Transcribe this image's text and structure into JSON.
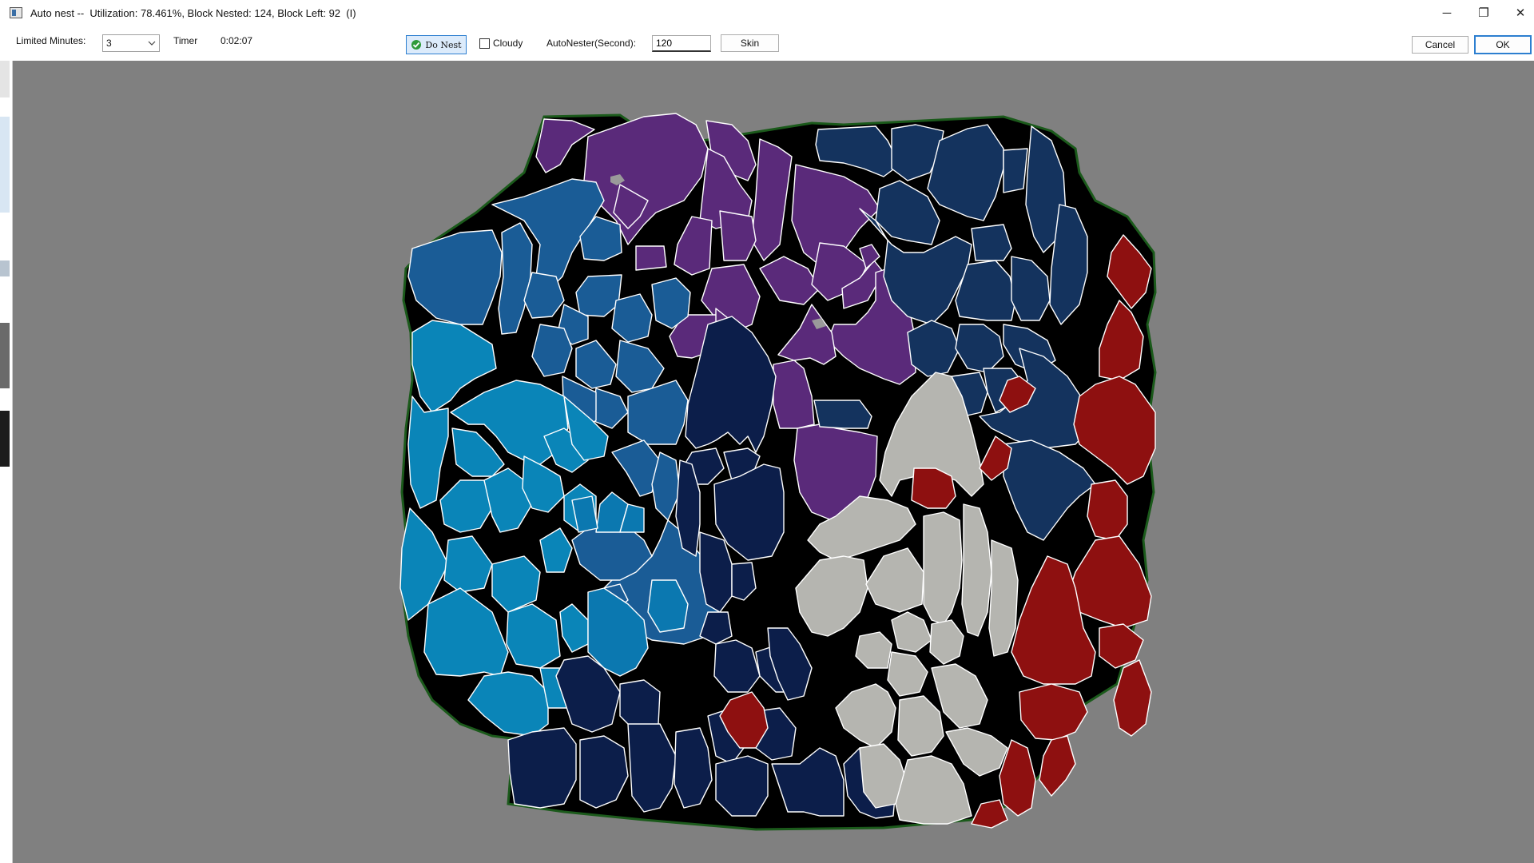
{
  "window": {
    "title": "Auto nest --  Utilization: 78.461%, Block Nested: 124, Block Left: 92  (I)",
    "minimize_glyph": "─",
    "maximize_glyph": "❐",
    "close_glyph": "✕"
  },
  "toolbar": {
    "limited_minutes_label": "Limited Minutes:",
    "limited_minutes_value": "3",
    "timer_label": "Timer",
    "timer_value": "0:02:07",
    "do_nest_label": "Do Nest",
    "cloudy_label": "Cloudy",
    "cloudy_checked": false,
    "autonester_label": "AutoNester(Second):",
    "autonester_value": "120",
    "skin_label": "Skin",
    "cancel_label": "Cancel",
    "ok_label": "OK"
  },
  "icons": {
    "app": "app-window-icon",
    "dropdown": "chevron-down-icon",
    "do_nest": "checkmark-icon"
  },
  "colors": {
    "canvas_bg": "#808080",
    "hide_bg": "#000000",
    "hide_outline": "#1b5a1b",
    "piece_stroke": "#ffffff",
    "purple": "#5a2a7a",
    "blue": "#1a5c96",
    "cyan": "#0a85b8",
    "light_blue": "#0b78b0",
    "navy": "#14335e",
    "dark_navy": "#0c1e4a",
    "grey": "#b5b5b0",
    "red": "#8e1010",
    "accent": "#2d7fd0"
  }
}
